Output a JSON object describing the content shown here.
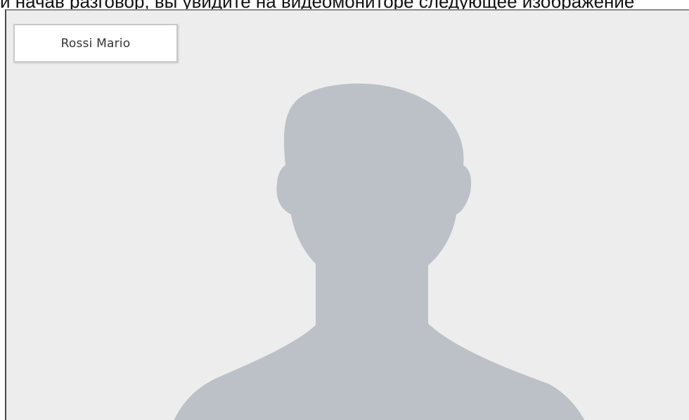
{
  "document": {
    "caption_line": "и начав разговор, вы увидите на видеомониторе следующее изображение"
  },
  "monitor": {
    "caller_name": "Rossi Mario",
    "avatar_icon": "person-silhouette-icon",
    "colors": {
      "screen_background": "#ededed",
      "silhouette": "#bcc1c7",
      "name_box_background": "#ffffff"
    }
  }
}
